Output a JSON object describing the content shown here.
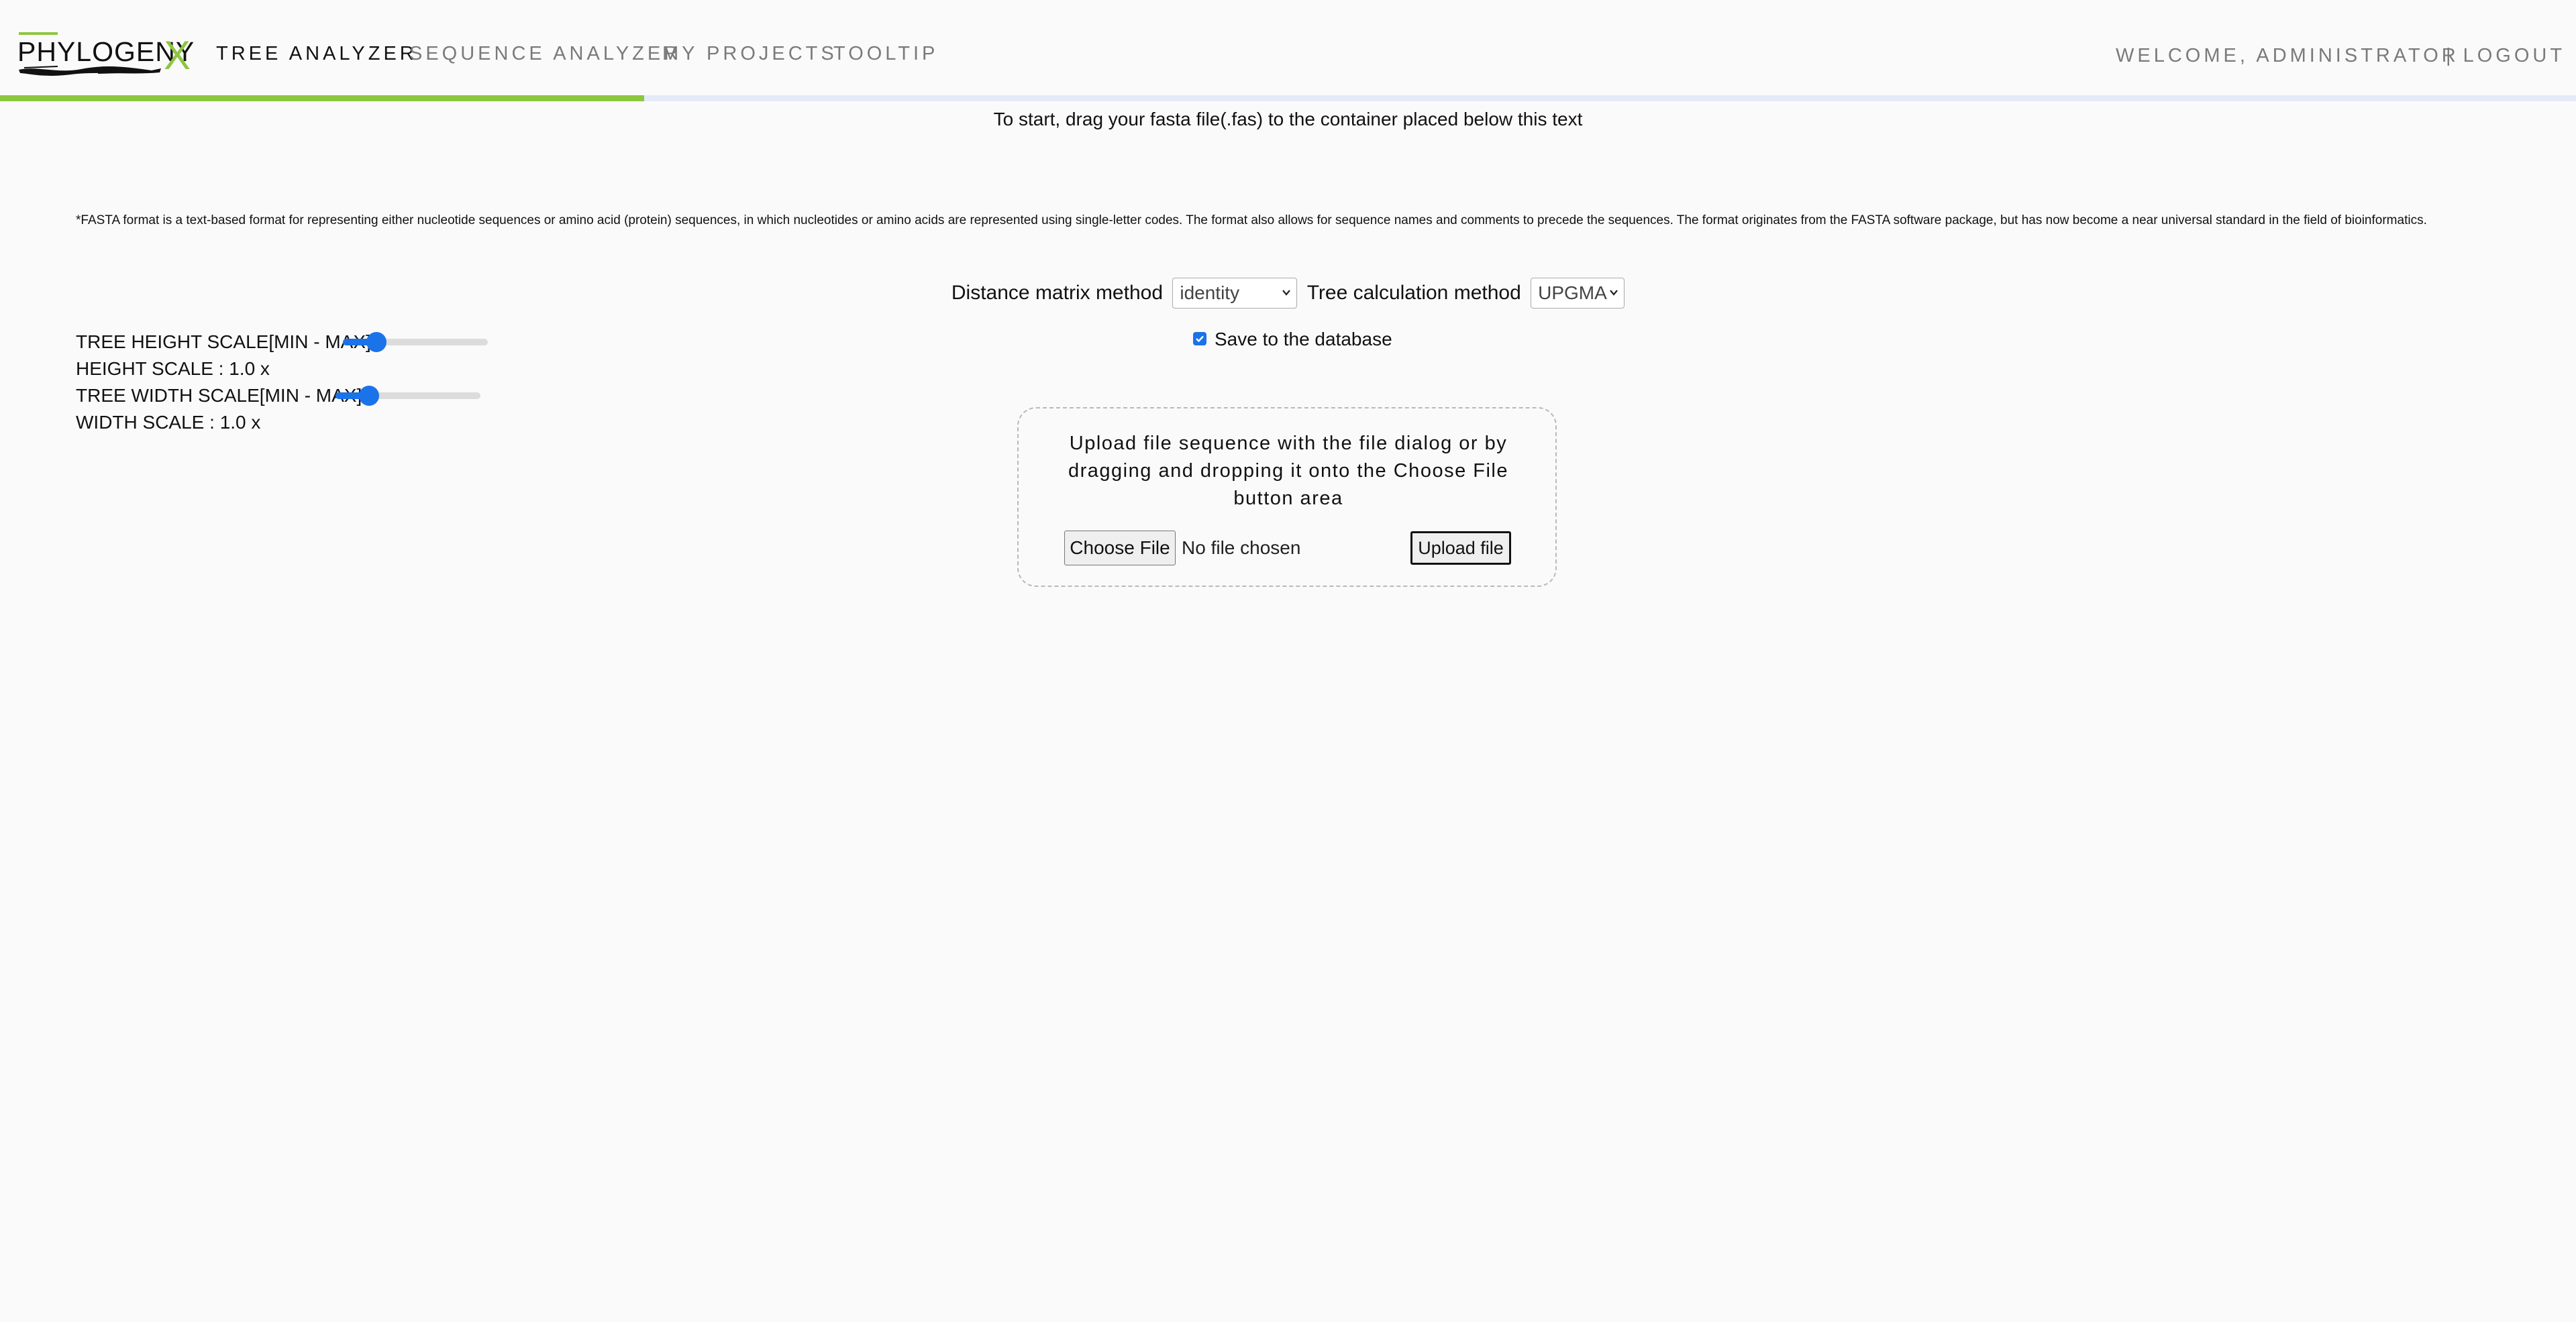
{
  "brand": {
    "logo_text": "PHYLOGENY",
    "logo_x": "X",
    "accent_color": "#8dc63f"
  },
  "nav": {
    "tree_analyzer": "TREE ANALYZER",
    "sequence_analyzer": "SEQUENCE ANALYZER",
    "my_projects": "MY PROJECTS",
    "tooltip": "TOOLTIP",
    "active": "TREE ANALYZER"
  },
  "user": {
    "welcome": "WELCOME, ADMINISTRATOR",
    "logout": "| LOGOUT"
  },
  "progress": {
    "fraction": 0.25,
    "fill_color": "#8dc63f",
    "track_color": "#e4eaf6"
  },
  "intro_text": "To start, drag your fasta file(.fas) to the container placed below this text",
  "fasta_note": "*FASTA format is a text-based format for representing either nucleotide sequences or amino acid (protein) sequences, in which nucleotides or amino acids are represented using single-letter codes. The format also allows for sequence names and comments to precede the sequences. The format originates from the FASTA software package, but has now become a near universal standard in the field of bioinformatics.",
  "methods": {
    "distance_label": "Distance matrix method",
    "distance_value": "identity",
    "tree_label": "Tree calculation method",
    "tree_value": "UPGMA"
  },
  "scales": {
    "height_label": "TREE HEIGHT SCALE[MIN - MAX]",
    "height_value_text": "HEIGHT SCALE : 1.0 x",
    "height_slider_fraction": 0.23,
    "width_label": "TREE WIDTH SCALE[MIN - MAX]",
    "width_value_text": "WIDTH SCALE : 1.0 x",
    "width_slider_fraction": 0.23,
    "slider_color": "#1a73e8"
  },
  "save": {
    "label": "Save to the database",
    "checked": true
  },
  "upload": {
    "instructions": "Upload file sequence with the file dialog or by dragging and dropping it onto the Choose File button area",
    "choose_label": "Choose File",
    "no_file_text": "No file chosen",
    "upload_label": "Upload file"
  },
  "icons": {
    "select_chevron": "chevron-down-icon",
    "checkbox_check": "check-icon"
  }
}
